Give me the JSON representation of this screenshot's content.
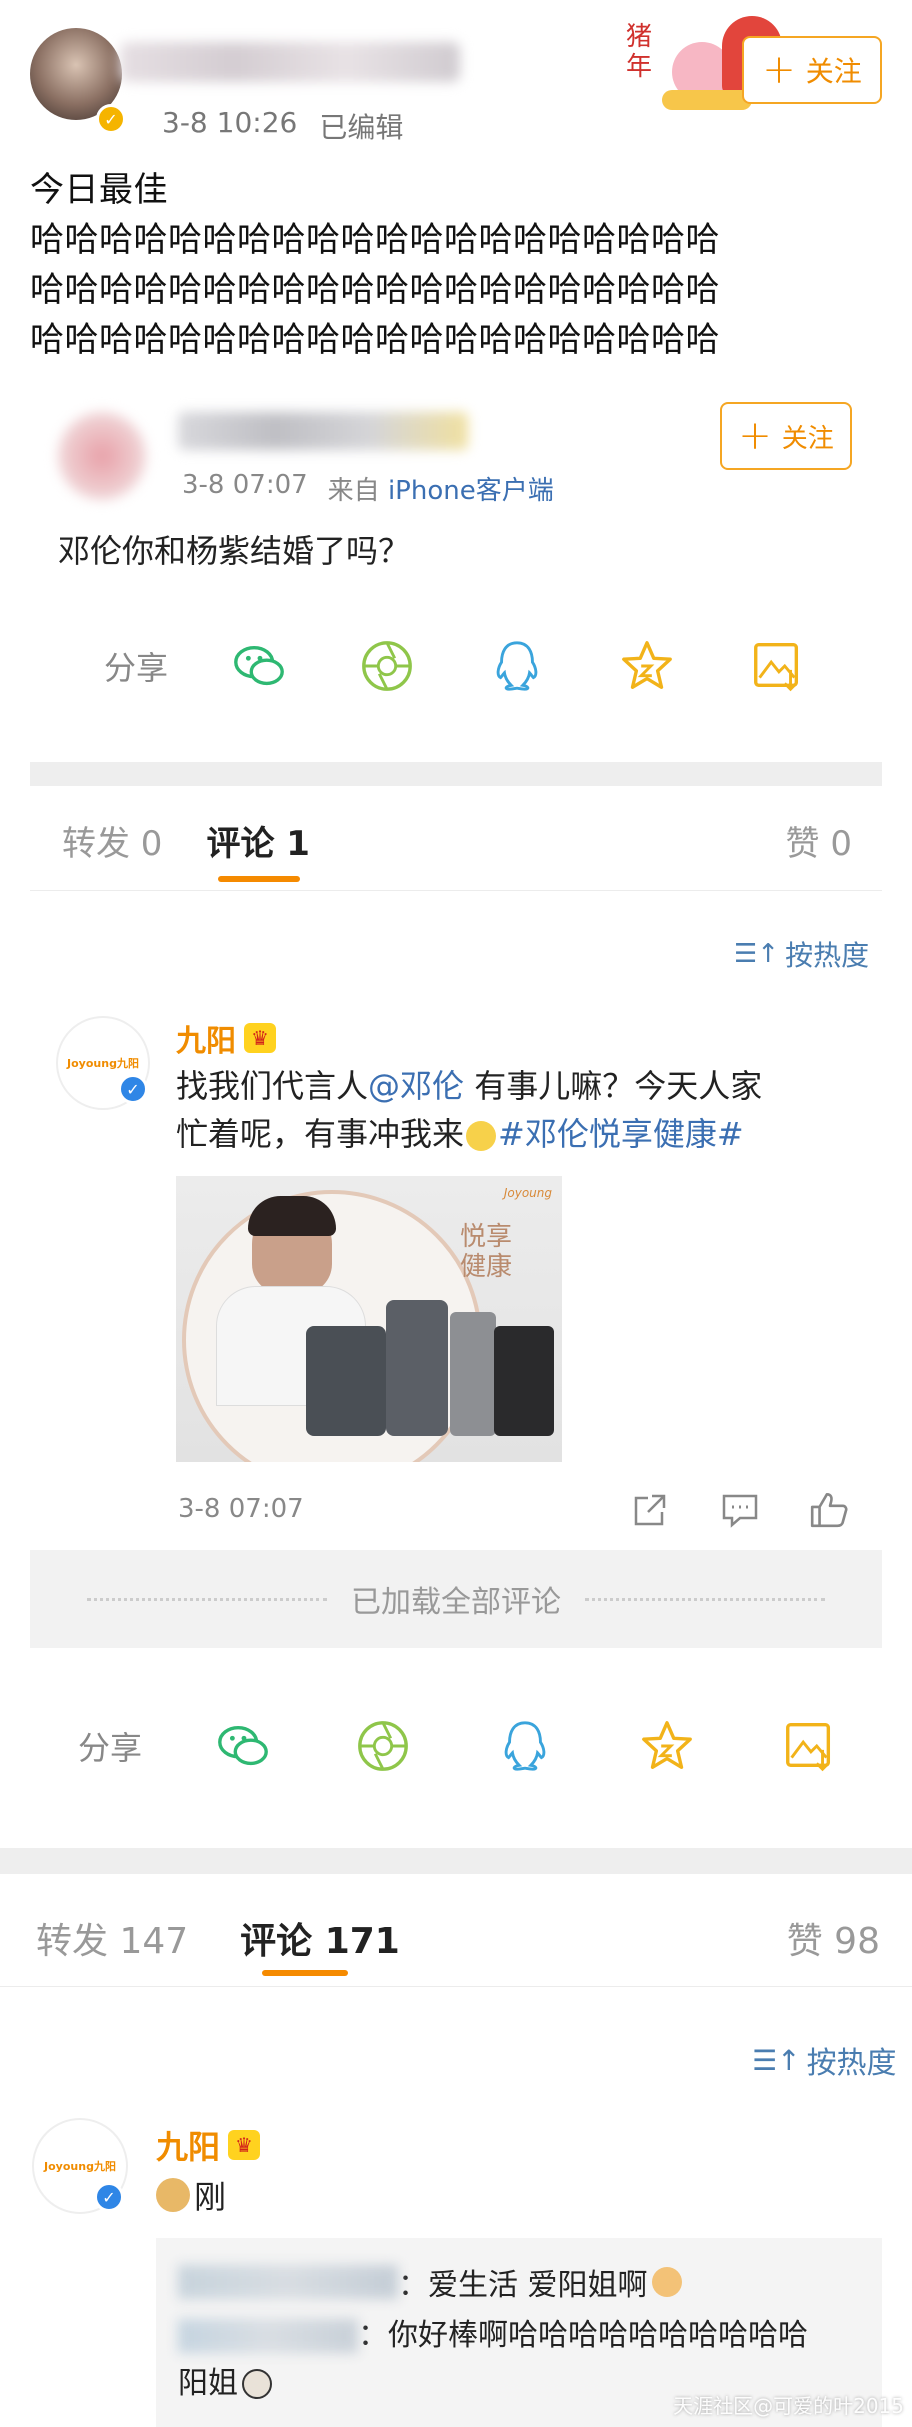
{
  "post": {
    "timestamp": "3-8 10:26",
    "edited": "已编辑",
    "text_lines": [
      "今日最佳",
      "哈哈哈哈哈哈哈哈哈哈哈哈哈哈哈哈哈哈哈哈哈哈哈哈哈哈哈哈哈哈哈哈哈哈哈哈哈哈哈哈哈哈"
    ],
    "line1": "今日最佳",
    "line2": "哈哈哈哈哈哈哈哈哈哈哈哈哈哈哈哈哈哈哈哈",
    "line3": "哈哈哈哈哈哈哈哈哈哈哈哈哈哈哈哈哈哈哈哈",
    "line4": "哈哈哈哈哈哈哈哈哈哈哈哈哈哈哈哈哈哈哈哈",
    "follow_label": "关注",
    "sticker_text": "猪年"
  },
  "embedded": {
    "timestamp": "3-8 07:07",
    "source_prefix": "来自",
    "source": "iPhone客户端",
    "text": "邓伦你和杨紫结婚了吗？",
    "follow_label": "关注",
    "share_label": "分享",
    "tabs": {
      "repost": "转发 0",
      "comments": "评论 1",
      "likes": "赞 0"
    },
    "sort_label": "按热度",
    "comment": {
      "name": "九阳",
      "avatar_text": "Joyoung九阳",
      "text_part1": "找我们代言人",
      "mention": "@邓伦",
      "text_part2": " 有事儿嘛？今天人家忙着呢，有事冲我来",
      "hashtag": "#邓伦悦享健康#",
      "line1_a": "找我们代言人",
      "line1_mention": "@邓伦",
      "line1_b": " 有事儿嘛？今天人家",
      "line2_a": "忙着呢，有事冲我来",
      "line2_hashtag": "#邓伦悦享健康#",
      "timestamp": "3-8 07:07",
      "image_brand": "Joyoung",
      "image_title": "悦享健康"
    },
    "loaded_all": "已加载全部评论"
  },
  "main": {
    "share_label": "分享",
    "tabs": {
      "repost": "转发 147",
      "comments": "评论 171",
      "likes": "赞 98"
    },
    "sort_label": "按热度",
    "comment": {
      "name": "九阳",
      "avatar_text": "Joyoung九阳",
      "text": "刚",
      "reply1": "：爱生活 爱阳姐啊",
      "reply2_line1": "：你好棒啊哈哈哈哈哈哈哈哈哈哈",
      "reply2_line2": "阳姐"
    }
  },
  "watermark": "天涯社区@可爱的叶2015",
  "colors": {
    "accent": "#f08c00",
    "link": "#3b6fb2",
    "band": "#eeeeee"
  }
}
